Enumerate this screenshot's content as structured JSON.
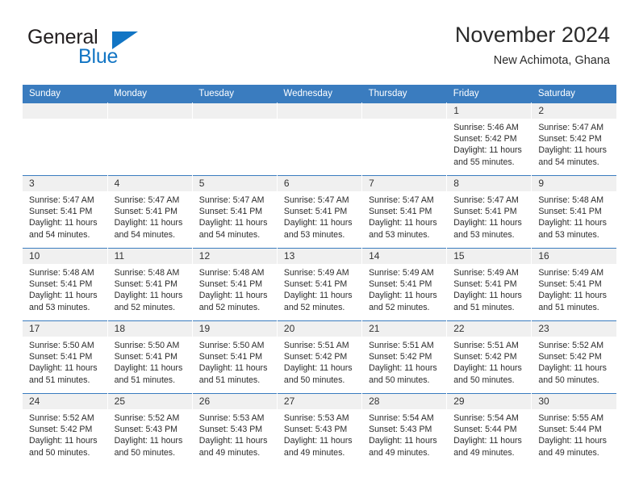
{
  "logo": {
    "word_one": "General",
    "word_two": "Blue",
    "triangle_icon": "blue-triangle-icon",
    "brand_color": "#1275c4"
  },
  "header": {
    "title": "November 2024",
    "subtitle": "New Achimota, Ghana"
  },
  "theme": {
    "header_blue": "#3a7cbf",
    "daynum_band": "#f0f0f0",
    "text": "#2c2c2c"
  },
  "weekday_headers": [
    "Sunday",
    "Monday",
    "Tuesday",
    "Wednesday",
    "Thursday",
    "Friday",
    "Saturday"
  ],
  "labels": {
    "sunrise_prefix": "Sunrise: ",
    "sunset_prefix": "Sunset: ",
    "daylight_prefix": "Daylight: "
  },
  "weeks": [
    [
      {
        "date": "",
        "empty": true
      },
      {
        "date": "",
        "empty": true
      },
      {
        "date": "",
        "empty": true
      },
      {
        "date": "",
        "empty": true
      },
      {
        "date": "",
        "empty": true
      },
      {
        "date": "1",
        "sunrise": "Sunrise: 5:46 AM",
        "sunset": "Sunset: 5:42 PM",
        "daylight_line1": "Daylight: 11 hours",
        "daylight_line2": "and 55 minutes."
      },
      {
        "date": "2",
        "sunrise": "Sunrise: 5:47 AM",
        "sunset": "Sunset: 5:42 PM",
        "daylight_line1": "Daylight: 11 hours",
        "daylight_line2": "and 54 minutes."
      }
    ],
    [
      {
        "date": "3",
        "sunrise": "Sunrise: 5:47 AM",
        "sunset": "Sunset: 5:41 PM",
        "daylight_line1": "Daylight: 11 hours",
        "daylight_line2": "and 54 minutes."
      },
      {
        "date": "4",
        "sunrise": "Sunrise: 5:47 AM",
        "sunset": "Sunset: 5:41 PM",
        "daylight_line1": "Daylight: 11 hours",
        "daylight_line2": "and 54 minutes."
      },
      {
        "date": "5",
        "sunrise": "Sunrise: 5:47 AM",
        "sunset": "Sunset: 5:41 PM",
        "daylight_line1": "Daylight: 11 hours",
        "daylight_line2": "and 54 minutes."
      },
      {
        "date": "6",
        "sunrise": "Sunrise: 5:47 AM",
        "sunset": "Sunset: 5:41 PM",
        "daylight_line1": "Daylight: 11 hours",
        "daylight_line2": "and 53 minutes."
      },
      {
        "date": "7",
        "sunrise": "Sunrise: 5:47 AM",
        "sunset": "Sunset: 5:41 PM",
        "daylight_line1": "Daylight: 11 hours",
        "daylight_line2": "and 53 minutes."
      },
      {
        "date": "8",
        "sunrise": "Sunrise: 5:47 AM",
        "sunset": "Sunset: 5:41 PM",
        "daylight_line1": "Daylight: 11 hours",
        "daylight_line2": "and 53 minutes."
      },
      {
        "date": "9",
        "sunrise": "Sunrise: 5:48 AM",
        "sunset": "Sunset: 5:41 PM",
        "daylight_line1": "Daylight: 11 hours",
        "daylight_line2": "and 53 minutes."
      }
    ],
    [
      {
        "date": "10",
        "sunrise": "Sunrise: 5:48 AM",
        "sunset": "Sunset: 5:41 PM",
        "daylight_line1": "Daylight: 11 hours",
        "daylight_line2": "and 53 minutes."
      },
      {
        "date": "11",
        "sunrise": "Sunrise: 5:48 AM",
        "sunset": "Sunset: 5:41 PM",
        "daylight_line1": "Daylight: 11 hours",
        "daylight_line2": "and 52 minutes."
      },
      {
        "date": "12",
        "sunrise": "Sunrise: 5:48 AM",
        "sunset": "Sunset: 5:41 PM",
        "daylight_line1": "Daylight: 11 hours",
        "daylight_line2": "and 52 minutes."
      },
      {
        "date": "13",
        "sunrise": "Sunrise: 5:49 AM",
        "sunset": "Sunset: 5:41 PM",
        "daylight_line1": "Daylight: 11 hours",
        "daylight_line2": "and 52 minutes."
      },
      {
        "date": "14",
        "sunrise": "Sunrise: 5:49 AM",
        "sunset": "Sunset: 5:41 PM",
        "daylight_line1": "Daylight: 11 hours",
        "daylight_line2": "and 52 minutes."
      },
      {
        "date": "15",
        "sunrise": "Sunrise: 5:49 AM",
        "sunset": "Sunset: 5:41 PM",
        "daylight_line1": "Daylight: 11 hours",
        "daylight_line2": "and 51 minutes."
      },
      {
        "date": "16",
        "sunrise": "Sunrise: 5:49 AM",
        "sunset": "Sunset: 5:41 PM",
        "daylight_line1": "Daylight: 11 hours",
        "daylight_line2": "and 51 minutes."
      }
    ],
    [
      {
        "date": "17",
        "sunrise": "Sunrise: 5:50 AM",
        "sunset": "Sunset: 5:41 PM",
        "daylight_line1": "Daylight: 11 hours",
        "daylight_line2": "and 51 minutes."
      },
      {
        "date": "18",
        "sunrise": "Sunrise: 5:50 AM",
        "sunset": "Sunset: 5:41 PM",
        "daylight_line1": "Daylight: 11 hours",
        "daylight_line2": "and 51 minutes."
      },
      {
        "date": "19",
        "sunrise": "Sunrise: 5:50 AM",
        "sunset": "Sunset: 5:41 PM",
        "daylight_line1": "Daylight: 11 hours",
        "daylight_line2": "and 51 minutes."
      },
      {
        "date": "20",
        "sunrise": "Sunrise: 5:51 AM",
        "sunset": "Sunset: 5:42 PM",
        "daylight_line1": "Daylight: 11 hours",
        "daylight_line2": "and 50 minutes."
      },
      {
        "date": "21",
        "sunrise": "Sunrise: 5:51 AM",
        "sunset": "Sunset: 5:42 PM",
        "daylight_line1": "Daylight: 11 hours",
        "daylight_line2": "and 50 minutes."
      },
      {
        "date": "22",
        "sunrise": "Sunrise: 5:51 AM",
        "sunset": "Sunset: 5:42 PM",
        "daylight_line1": "Daylight: 11 hours",
        "daylight_line2": "and 50 minutes."
      },
      {
        "date": "23",
        "sunrise": "Sunrise: 5:52 AM",
        "sunset": "Sunset: 5:42 PM",
        "daylight_line1": "Daylight: 11 hours",
        "daylight_line2": "and 50 minutes."
      }
    ],
    [
      {
        "date": "24",
        "sunrise": "Sunrise: 5:52 AM",
        "sunset": "Sunset: 5:42 PM",
        "daylight_line1": "Daylight: 11 hours",
        "daylight_line2": "and 50 minutes."
      },
      {
        "date": "25",
        "sunrise": "Sunrise: 5:52 AM",
        "sunset": "Sunset: 5:43 PM",
        "daylight_line1": "Daylight: 11 hours",
        "daylight_line2": "and 50 minutes."
      },
      {
        "date": "26",
        "sunrise": "Sunrise: 5:53 AM",
        "sunset": "Sunset: 5:43 PM",
        "daylight_line1": "Daylight: 11 hours",
        "daylight_line2": "and 49 minutes."
      },
      {
        "date": "27",
        "sunrise": "Sunrise: 5:53 AM",
        "sunset": "Sunset: 5:43 PM",
        "daylight_line1": "Daylight: 11 hours",
        "daylight_line2": "and 49 minutes."
      },
      {
        "date": "28",
        "sunrise": "Sunrise: 5:54 AM",
        "sunset": "Sunset: 5:43 PM",
        "daylight_line1": "Daylight: 11 hours",
        "daylight_line2": "and 49 minutes."
      },
      {
        "date": "29",
        "sunrise": "Sunrise: 5:54 AM",
        "sunset": "Sunset: 5:44 PM",
        "daylight_line1": "Daylight: 11 hours",
        "daylight_line2": "and 49 minutes."
      },
      {
        "date": "30",
        "sunrise": "Sunrise: 5:55 AM",
        "sunset": "Sunset: 5:44 PM",
        "daylight_line1": "Daylight: 11 hours",
        "daylight_line2": "and 49 minutes."
      }
    ]
  ]
}
